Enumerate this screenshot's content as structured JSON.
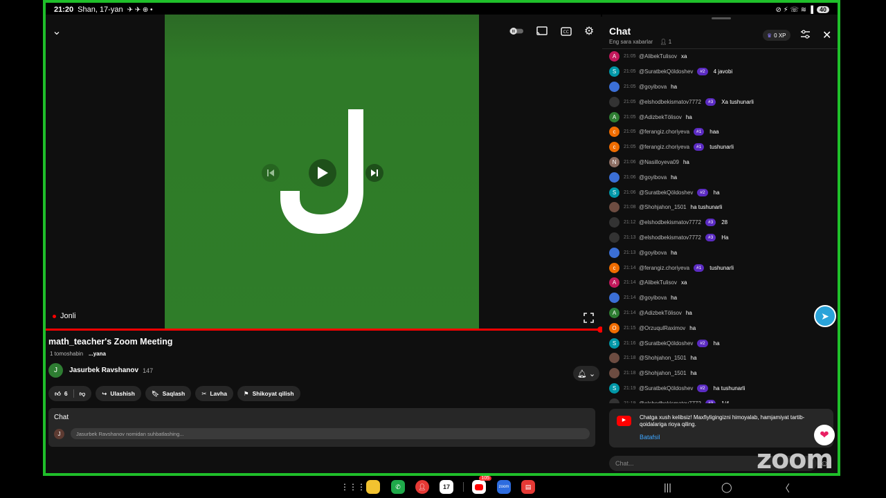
{
  "status": {
    "time": "21:20",
    "date": "Shan, 17-yan",
    "battery": "40"
  },
  "video": {
    "letter": "J",
    "live_label": "Jonli"
  },
  "info": {
    "title": "math_teacher's Zoom Meeting",
    "views": "1 tomoshabin",
    "more": "...yana",
    "channel_avatar": "J",
    "channel_name": "Jasurbek Ravshanov",
    "subscribers": "147",
    "likes": "6",
    "share": "Ulashish",
    "save": "Saqlash",
    "clip": "Lavha",
    "report": "Shikoyat qilish",
    "chat_label": "Chat",
    "chat_avatar": "J",
    "chat_placeholder": "Jasurbek Ravshanov nomidan suhbatlashing..."
  },
  "chat": {
    "title": "Chat",
    "subtitle": "Eng sara xabarlar",
    "viewers": "1",
    "xp": "0 XP",
    "messages": [
      {
        "av": "A",
        "color": "#c2185b",
        "time": "21:05",
        "user": "@AlibekTulisov",
        "badge": "",
        "text": "xa"
      },
      {
        "av": "S",
        "color": "#0097a7",
        "time": "21:05",
        "user": "@SuratbekQöldoshev",
        "badge": "#2",
        "text": "4 javobi"
      },
      {
        "av": "",
        "color": "#3b6fd6",
        "time": "21:05",
        "user": "@goyibova",
        "badge": "",
        "text": "ha"
      },
      {
        "av": "",
        "color": "#333",
        "time": "21:05",
        "user": "@elshodbekismatov7772",
        "badge": "#3",
        "text": "Xa tushunarli"
      },
      {
        "av": "A",
        "color": "#2e7d32",
        "time": "21:05",
        "user": "@AdizbekTölisov",
        "badge": "",
        "text": "ha"
      },
      {
        "av": "c",
        "color": "#ef6c00",
        "time": "21:05",
        "user": "@ferangiz.choriyeva",
        "badge": "#1",
        "text": "haa"
      },
      {
        "av": "c",
        "color": "#ef6c00",
        "time": "21:05",
        "user": "@ferangiz.choriyeva",
        "badge": "#1",
        "text": "tushunarli"
      },
      {
        "av": "N",
        "color": "#8d6e63",
        "time": "21:06",
        "user": "@Nasilloyeva09",
        "badge": "",
        "text": "ha"
      },
      {
        "av": "",
        "color": "#3b6fd6",
        "time": "21:06",
        "user": "@goyibova",
        "badge": "",
        "text": "ha"
      },
      {
        "av": "S",
        "color": "#0097a7",
        "time": "21:06",
        "user": "@SuratbekQöldoshev",
        "badge": "#2",
        "text": "ha"
      },
      {
        "av": "",
        "color": "#6d4c41",
        "time": "21:08",
        "user": "@Shohjahon_1501",
        "badge": "",
        "text": "ha tushunarli"
      },
      {
        "av": "",
        "color": "#333",
        "time": "21:12",
        "user": "@elshodbekismatov7772",
        "badge": "#3",
        "text": "28"
      },
      {
        "av": "",
        "color": "#333",
        "time": "21:13",
        "user": "@elshodbekismatov7772",
        "badge": "#3",
        "text": "Ha"
      },
      {
        "av": "",
        "color": "#3b6fd6",
        "time": "21:13",
        "user": "@goyibova",
        "badge": "",
        "text": "ha"
      },
      {
        "av": "c",
        "color": "#ef6c00",
        "time": "21:14",
        "user": "@ferangiz.choriyeva",
        "badge": "#1",
        "text": "tushunarli"
      },
      {
        "av": "A",
        "color": "#c2185b",
        "time": "21:14",
        "user": "@AlibekTulisov",
        "badge": "",
        "text": "xa"
      },
      {
        "av": "",
        "color": "#3b6fd6",
        "time": "21:14",
        "user": "@goyibova",
        "badge": "",
        "text": "ha"
      },
      {
        "av": "A",
        "color": "#2e7d32",
        "time": "21:14",
        "user": "@AdizbekTölisov",
        "badge": "",
        "text": "ha"
      },
      {
        "av": "O",
        "color": "#ef6c00",
        "time": "21:15",
        "user": "@OrzuqulRaximov",
        "badge": "",
        "text": "ha"
      },
      {
        "av": "S",
        "color": "#0097a7",
        "time": "21:16",
        "user": "@SuratbekQöldoshev",
        "badge": "#2",
        "text": "ha"
      },
      {
        "av": "",
        "color": "#6d4c41",
        "time": "21:18",
        "user": "@Shohjahon_1501",
        "badge": "",
        "text": "ha"
      },
      {
        "av": "",
        "color": "#6d4c41",
        "time": "21:18",
        "user": "@Shohjahon_1501",
        "badge": "",
        "text": "ha"
      },
      {
        "av": "S",
        "color": "#0097a7",
        "time": "21:19",
        "user": "@SuratbekQöldoshev",
        "badge": "#2",
        "text": "ha tushunarli"
      },
      {
        "av": "",
        "color": "#333",
        "time": "21:19",
        "user": "@elshodbekismatov7772",
        "badge": "#3",
        "text": "1/4"
      }
    ],
    "welcome_text": "Chatga xush kelibsiz! Maxfiyligingizni himoyalab, hamjamiyat tartib-qoidalariga rioya qiling.",
    "welcome_link": "Batafsil",
    "input_placeholder": "Chat..."
  },
  "overlay": {
    "zoom_logo": "zoom"
  },
  "dock": {
    "youtube_badge": "105",
    "calendar_day": "17",
    "zoom_label": "zoom"
  },
  "colors": {
    "frame": "#1fbf2a",
    "accent": "#ff0000",
    "badge": "#5b2bc2",
    "link": "#3ea6ff"
  }
}
